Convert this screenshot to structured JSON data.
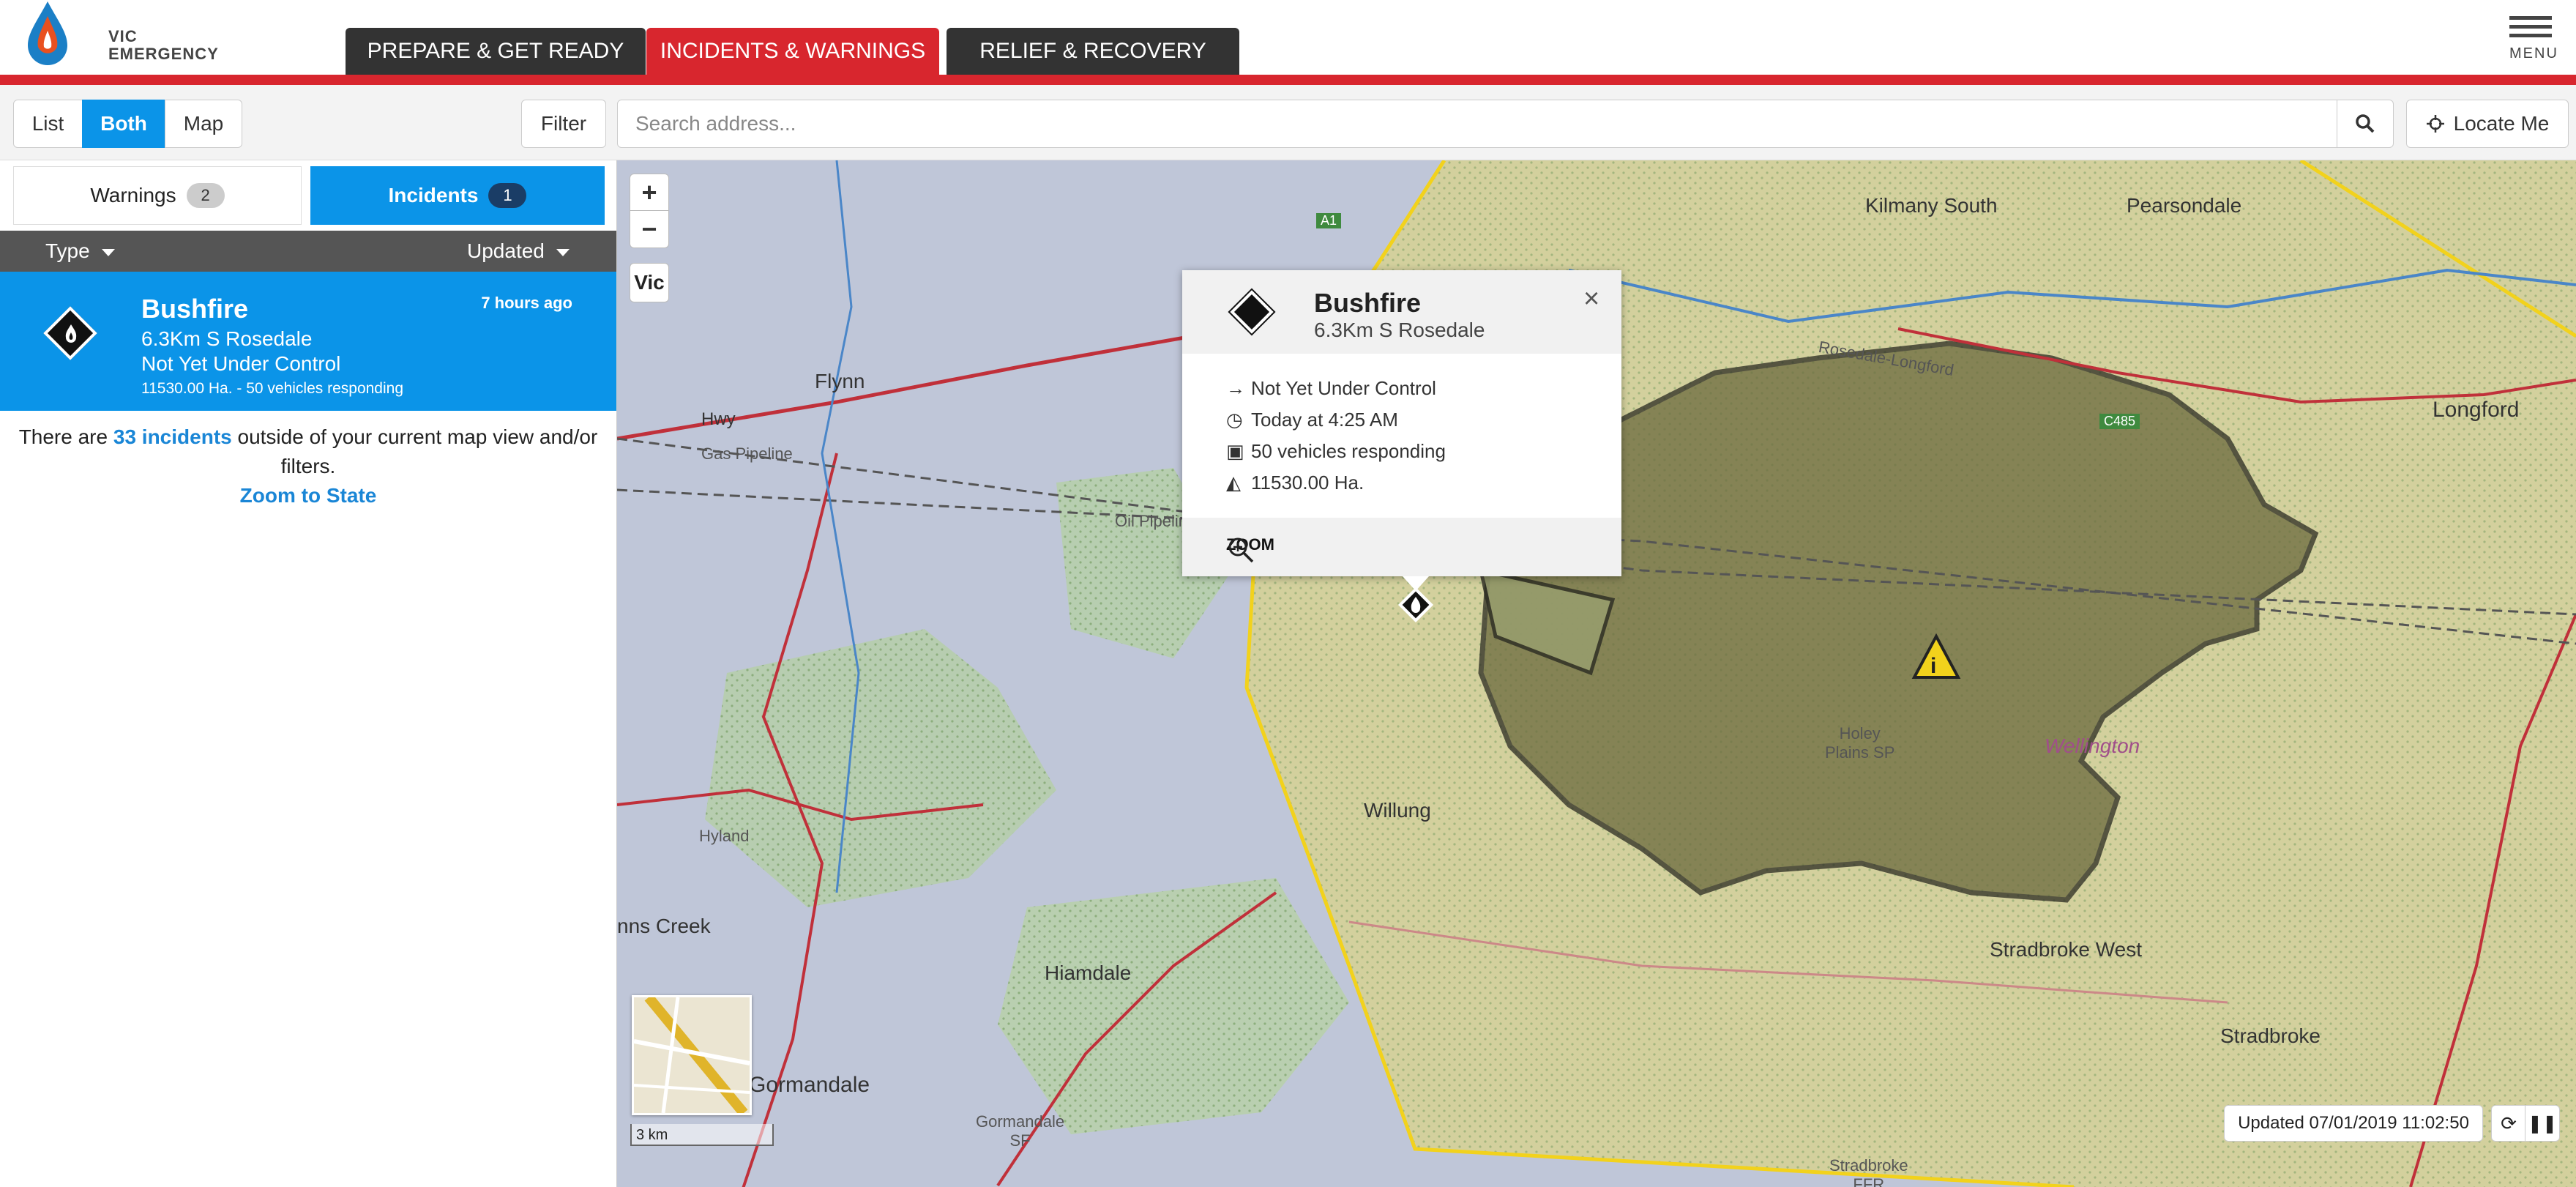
{
  "header": {
    "logo_text_line1": "VIC",
    "logo_text_line2": "EMERGENCY",
    "nav_tabs": [
      {
        "label": "PREPARE & GET READY"
      },
      {
        "label": "INCIDENTS & WARNINGS"
      },
      {
        "label": "RELIEF & RECOVERY"
      }
    ],
    "menu_label": "MENU"
  },
  "toolbar": {
    "view_list": "List",
    "view_both": "Both",
    "view_map": "Map",
    "filter_label": "Filter",
    "search_placeholder": "Search address...",
    "locate_label": "Locate Me"
  },
  "sidebar": {
    "tabs": [
      {
        "label": "Warnings",
        "count": "2"
      },
      {
        "label": "Incidents",
        "count": "1"
      }
    ],
    "sort_type": "Type",
    "sort_updated": "Updated",
    "incident": {
      "title": "Bushfire",
      "time": "7 hours ago",
      "location": "6.3Km S Rosedale",
      "status": "Not Yet Under Control",
      "detail": "11530.00 Ha. - 50 vehicles responding"
    },
    "note_prefix": "There are",
    "note_count": "33 incidents",
    "note_suffix": "outside of your current map view and/or filters.",
    "zoom_to_state": "Zoom to State"
  },
  "map": {
    "zoom_in": "+",
    "zoom_out": "−",
    "vic_label": "Vic",
    "scale_label": "3 km",
    "updated_text": "Updated 07/01/2019 11:02:50",
    "labels": {
      "kilmany_south": "Kilmany South",
      "pearsondale": "Pearsondale",
      "longford": "Longford",
      "flynn": "Flynn",
      "hwy": "Hwy",
      "gas_pipeline": "Gas Pipeline",
      "oil_pipeline": "Oil Pipeline",
      "holey_plains": "Holey\nPlains SP",
      "wellington": "Wellington",
      "willung": "Willung",
      "hyland": "Hyland",
      "creek": "nns Creek",
      "hiamdale": "Hiamdale",
      "sormandale": "Gormandale",
      "gormandale_sf": "Gormandale\nSF",
      "stradbroke_west": "Stradbroke West",
      "stradbroke": "Stradbroke",
      "stradbroke_ffr": "Stradbroke\nFFR",
      "rosedale_longford": "Rosedale-Longford",
      "a1": "A1",
      "c485": "C485"
    },
    "popup": {
      "title": "Bushfire",
      "location": "6.3Km S Rosedale",
      "status": "Not Yet Under Control",
      "time": "Today at 4:25 AM",
      "vehicles": "50 vehicles responding",
      "area": "11530.00 Ha.",
      "zoom_label": "ZOOM"
    }
  },
  "colors": {
    "accent_red": "#d8262e",
    "accent_blue": "#0b94e8",
    "fire_area": "#6b6a3e",
    "warning_zone": "#f2d21c"
  }
}
